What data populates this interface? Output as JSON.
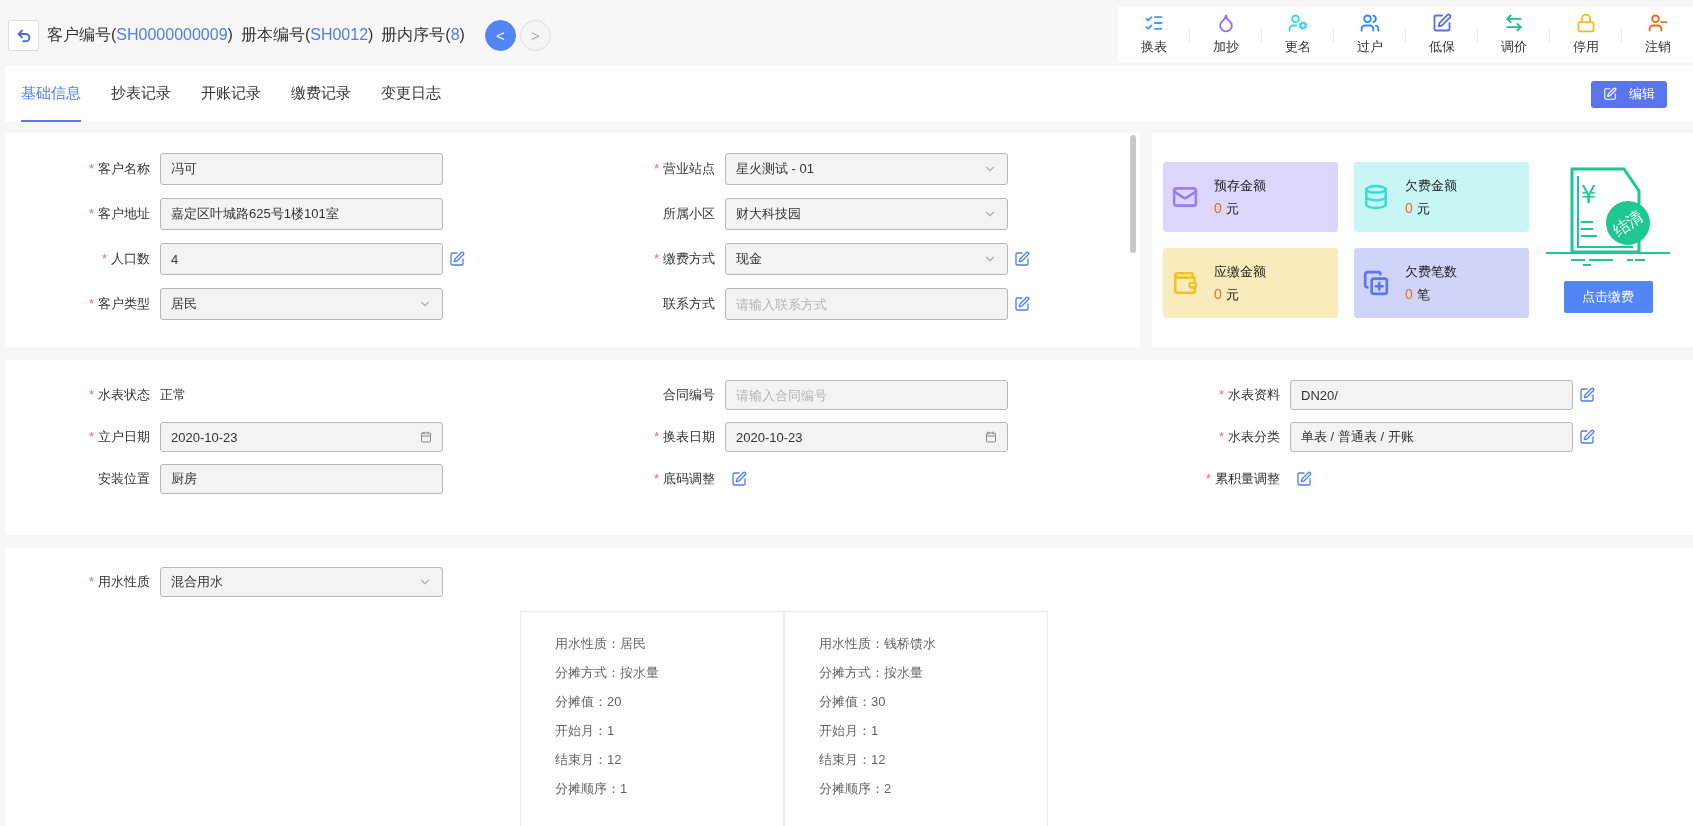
{
  "required_mark": "*",
  "header": {
    "title_parts": [
      {
        "label": "客户编号(",
        "value": "SH0000000009",
        "suffix": ")"
      },
      {
        "label": "册本编号(",
        "value": "SH0012",
        "suffix": ")"
      },
      {
        "label": "册内序号(",
        "value": "8",
        "suffix": ")"
      }
    ],
    "prev": {
      "glyph": "<",
      "disabled": false
    },
    "next": {
      "glyph": ">",
      "disabled": true
    }
  },
  "toolbar": [
    {
      "label": "换表",
      "kind": "checklist"
    },
    {
      "label": "加抄",
      "kind": "drop"
    },
    {
      "label": "更名",
      "kind": "usergear"
    },
    {
      "label": "过户",
      "kind": "users"
    },
    {
      "label": "低保",
      "kind": "pen"
    },
    {
      "label": "调价",
      "kind": "swap"
    },
    {
      "label": "停用",
      "kind": "lock"
    },
    {
      "label": "注销",
      "kind": "userminus"
    }
  ],
  "tabs": [
    {
      "label": "基础信息",
      "selected": true
    },
    {
      "label": "抄表记录",
      "selected": false
    },
    {
      "label": "开账记录",
      "selected": false
    },
    {
      "label": "缴费记录",
      "selected": false
    },
    {
      "label": "变更日志",
      "selected": false
    }
  ],
  "edit_button": "编辑",
  "customer_form": {
    "fields": [
      {
        "label": "客户名称",
        "required": true,
        "kind": "text",
        "value": "冯可",
        "editable": false
      },
      {
        "label": "营业站点",
        "required": true,
        "kind": "select",
        "value": "星火测试 - 01",
        "editable": false
      },
      {
        "label": "客户地址",
        "required": true,
        "kind": "text",
        "value": "嘉定区叶城路625号1楼101室",
        "editable": false
      },
      {
        "label": "所属小区",
        "required": false,
        "kind": "select",
        "value": "财大科技园",
        "editable": false
      },
      {
        "label": "人口数",
        "required": true,
        "kind": "text",
        "value": "4",
        "editable": true
      },
      {
        "label": "缴费方式",
        "required": true,
        "kind": "select",
        "value": "现金",
        "editable": true
      },
      {
        "label": "客户类型",
        "required": true,
        "kind": "select",
        "value": "居民",
        "editable": false
      },
      {
        "label": "联系方式",
        "required": false,
        "kind": "text",
        "placeholder": "请输入联系方式",
        "editable": true
      }
    ]
  },
  "summary": {
    "cards": [
      {
        "label": "预存金额",
        "amount": "0",
        "unit": "元",
        "kind": "deposit"
      },
      {
        "label": "欠费金额",
        "amount": "0",
        "unit": "元",
        "kind": "arrears"
      },
      {
        "label": "应缴金额",
        "amount": "0",
        "unit": "元",
        "kind": "due"
      },
      {
        "label": "欠费笔数",
        "amount": "0",
        "unit": "笔",
        "kind": "count"
      }
    ],
    "receipt_symbol": "¥",
    "stamp": "结清",
    "pay_button": "点击缴费"
  },
  "meter_form": {
    "fields": [
      {
        "label": "水表状态",
        "required": true,
        "kind": "static",
        "value": "正常",
        "editable": false
      },
      {
        "label": "合同编号",
        "required": false,
        "kind": "text",
        "placeholder": "请输入合同编号",
        "editable": false
      },
      {
        "label": "水表资料",
        "required": true,
        "kind": "text",
        "value": "DN20/",
        "editable": true
      },
      {
        "label": "立户日期",
        "required": true,
        "kind": "date",
        "value": "2020-10-23",
        "editable": false
      },
      {
        "label": "换表日期",
        "required": true,
        "kind": "date",
        "value": "2020-10-23",
        "editable": false
      },
      {
        "label": "水表分类",
        "required": true,
        "kind": "text",
        "value": "单表 / 普通表 / 开账",
        "editable": true
      },
      {
        "label": "安装位置",
        "required": false,
        "kind": "text",
        "value": "厨房",
        "editable": false
      },
      {
        "label": "底码调整",
        "required": true,
        "kind": "edit",
        "editable": true
      },
      {
        "label": "累积量调整",
        "required": true,
        "kind": "edit",
        "editable": true
      }
    ]
  },
  "usage": {
    "field": {
      "label": "用水性质",
      "required": true,
      "kind": "select",
      "value": "混合用水",
      "editable": false
    },
    "allocations": [
      {
        "lines": [
          {
            "label": "用水性质：",
            "value": "居民"
          },
          {
            "label": "分摊方式：",
            "value": "按水量"
          },
          {
            "label": "分摊值：",
            "value": "20"
          },
          {
            "label": "开始月：",
            "value": "1"
          },
          {
            "label": "结束月：",
            "value": "12"
          },
          {
            "label": "分摊顺序：",
            "value": "1"
          }
        ]
      },
      {
        "lines": [
          {
            "label": "用水性质：",
            "value": "钱桥馈水"
          },
          {
            "label": "分摊方式：",
            "value": "按水量"
          },
          {
            "label": "分摊值：",
            "value": "30"
          },
          {
            "label": "开始月：",
            "value": "1"
          },
          {
            "label": "结束月：",
            "value": "12"
          },
          {
            "label": "分摊顺序：",
            "value": "2"
          }
        ]
      }
    ]
  }
}
